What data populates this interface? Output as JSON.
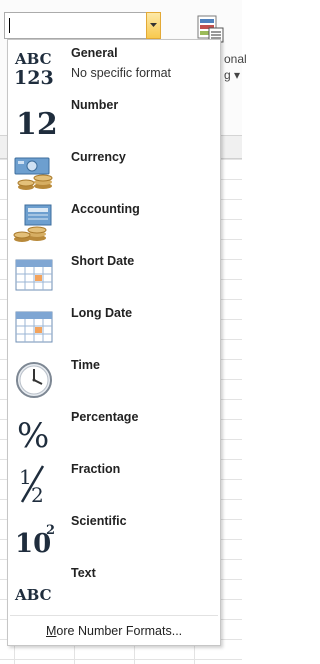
{
  "number_format_box": {
    "value": ""
  },
  "background": {
    "ribbon_text_1": "onal",
    "ribbon_text_2": "g ▾"
  },
  "menu": {
    "items": [
      {
        "label": "General",
        "sublabel": "No specific format",
        "icon": "general-abc123-icon"
      },
      {
        "label": "Number",
        "sublabel": "",
        "icon": "number-12-icon"
      },
      {
        "label": "Currency",
        "sublabel": "",
        "icon": "currency-banknote-icon"
      },
      {
        "label": "Accounting",
        "sublabel": "",
        "icon": "accounting-ledger-icon"
      },
      {
        "label": "Short Date",
        "sublabel": "",
        "icon": "calendar-icon"
      },
      {
        "label": "Long Date",
        "sublabel": "",
        "icon": "calendar-icon"
      },
      {
        "label": "Time",
        "sublabel": "",
        "icon": "clock-icon"
      },
      {
        "label": "Percentage",
        "sublabel": "",
        "icon": "percent-icon"
      },
      {
        "label": "Fraction",
        "sublabel": "",
        "icon": "fraction-half-icon"
      },
      {
        "label": "Scientific",
        "sublabel": "",
        "icon": "scientific-10-squared-icon"
      },
      {
        "label": "Text",
        "sublabel": "",
        "icon": "text-abc-icon"
      }
    ],
    "more_label_underlined": "M",
    "more_label_rest": "ore Number Formats..."
  },
  "colors": {
    "combo_button": "#f8c94f",
    "menu_border": "#c6c6c6",
    "calendar_blue": "#4f81bd",
    "coin_gold": "#c9a35b"
  }
}
